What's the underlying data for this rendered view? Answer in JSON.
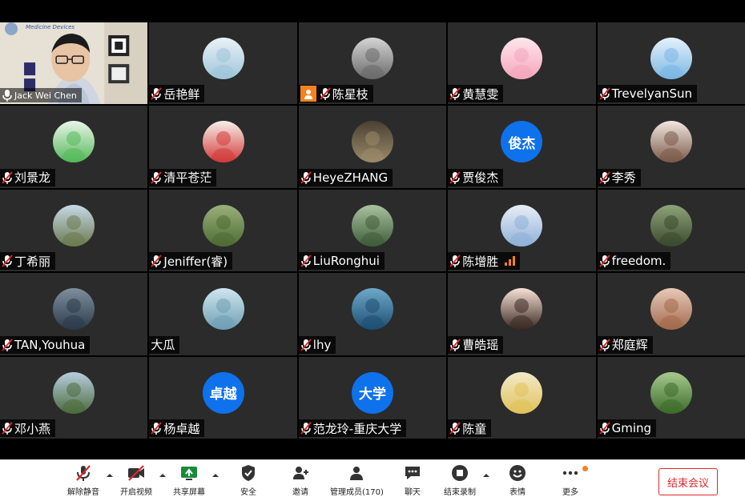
{
  "speaker": {
    "name": "Jack Wei Chen",
    "slide_text": "Medicine Devices"
  },
  "participants": [
    {
      "name": "岳艳鲜",
      "avatar": "photo",
      "colors": [
        "#e9f1f7",
        "#9fc5d9"
      ]
    },
    {
      "name": "陈星枝",
      "avatar": "photo",
      "colors": [
        "#d4d4d4",
        "#6a6a6a"
      ],
      "video_off_badge": true
    },
    {
      "name": "黄慧雯",
      "avatar": "photo",
      "colors": [
        "#ffe6ee",
        "#f4a6bb"
      ]
    },
    {
      "name": "TrevelyanSun",
      "avatar": "photo",
      "colors": [
        "#e6f1fb",
        "#7ab6e4"
      ]
    },
    {
      "name": " 刘景龙",
      "avatar": "photo",
      "colors": [
        "#eaf5e8",
        "#54b95a"
      ]
    },
    {
      "name": "清平苍茫",
      "avatar": "photo",
      "colors": [
        "#f6efe9",
        "#d33a3a"
      ]
    },
    {
      "name": "HeyeZHANG",
      "avatar": "photo",
      "colors": [
        "#4a4032",
        "#9a8a6a"
      ]
    },
    {
      "name": "贾俊杰",
      "avatar": "text",
      "avatar_text": "俊杰"
    },
    {
      "name": "李秀",
      "avatar": "photo",
      "colors": [
        "#f1e6df",
        "#7b5a4a"
      ]
    },
    {
      "name": "丁希丽",
      "avatar": "photo",
      "colors": [
        "#c7d9e8",
        "#6b7a4f"
      ]
    },
    {
      "name": "Jeniffer(睿)",
      "avatar": "photo",
      "colors": [
        "#9ab07a",
        "#4f6b34"
      ]
    },
    {
      "name": "LiuRonghui",
      "avatar": "photo",
      "colors": [
        "#a9c2a0",
        "#3f5d3a"
      ]
    },
    {
      "name": "陈增胜",
      "avatar": "photo",
      "colors": [
        "#e9eef6",
        "#8fb0d8"
      ],
      "signal": true
    },
    {
      "name": "freedom.",
      "avatar": "photo",
      "colors": [
        "#8fa37a",
        "#3b4a2e"
      ]
    },
    {
      "name": "TAN,Youhua",
      "avatar": "photo",
      "colors": [
        "#7f8f9e",
        "#2c3b4a"
      ]
    },
    {
      "name": "大瓜",
      "avatar": "photo",
      "colors": [
        "#cfe6f0",
        "#6f9fb3"
      ],
      "no_mic": true
    },
    {
      "name": "lhy",
      "avatar": "photo",
      "colors": [
        "#6fa8c9",
        "#1d4f73"
      ]
    },
    {
      "name": "曹皓瑶",
      "avatar": "photo",
      "colors": [
        "#f7e1d6",
        "#3a2a23"
      ]
    },
    {
      "name": "郑庭辉",
      "avatar": "photo",
      "colors": [
        "#e8c9b8",
        "#a26a4d"
      ]
    },
    {
      "name": "邓小燕",
      "avatar": "photo",
      "colors": [
        "#b7cde0",
        "#4d6b3c"
      ]
    },
    {
      "name": "杨卓越",
      "avatar": "text",
      "avatar_text": "卓越"
    },
    {
      "name": "范龙玲-重庆大学",
      "avatar": "text",
      "avatar_text": "大学"
    },
    {
      "name": "陈童",
      "avatar": "photo",
      "colors": [
        "#f3e9c9",
        "#e0c25a"
      ]
    },
    {
      "name": "Gming",
      "avatar": "photo",
      "colors": [
        "#a7c98f",
        "#3c6b2a"
      ]
    }
  ],
  "toolbar": {
    "unmute": "解除静音",
    "start_video": "开启视频",
    "share_screen": "共享屏幕",
    "security": "安全",
    "invite": "邀请",
    "manage_participants": "管理成员(170)",
    "chat": "聊天",
    "end_recording": "结束录制",
    "reactions": "表情",
    "more": "更多",
    "end_meeting": "结束会议"
  },
  "colors": {
    "tile_bg": "#2b2b2b",
    "accent_blue": "#0e72ed",
    "accent_orange": "#f5821f",
    "end_red": "#e02828"
  }
}
